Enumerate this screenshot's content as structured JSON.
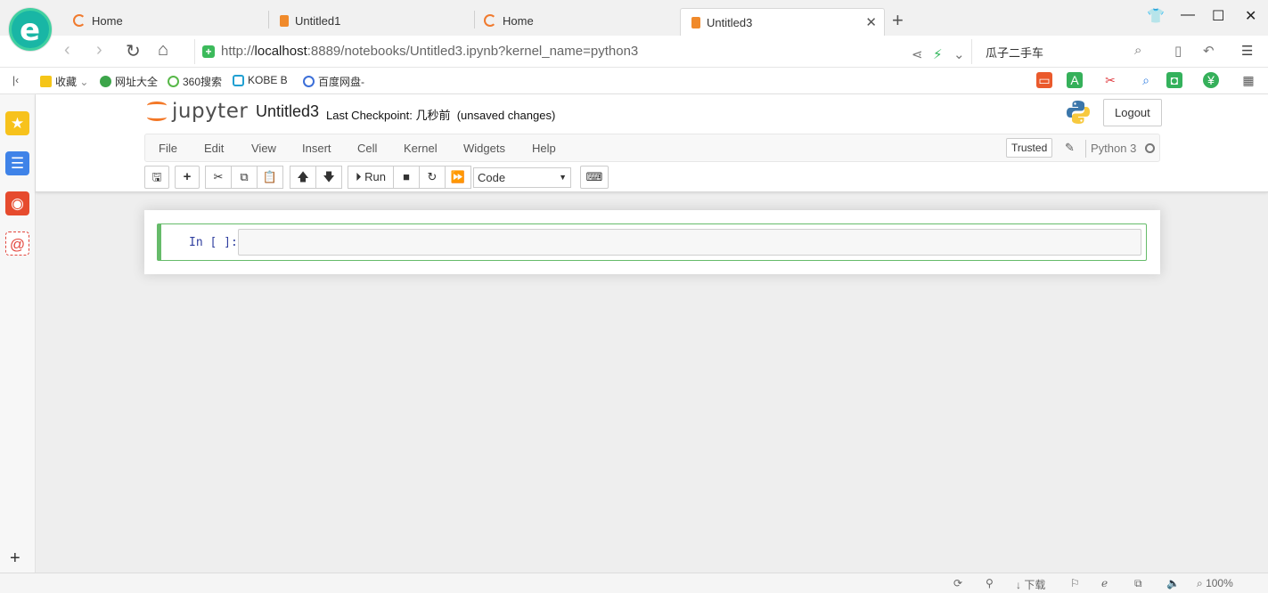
{
  "browser": {
    "tabs": [
      {
        "label": "Home",
        "active": false
      },
      {
        "label": "Untitled1",
        "active": false
      },
      {
        "label": "Home",
        "active": false
      },
      {
        "label": "Untitled3",
        "active": true
      }
    ],
    "url_prefix": "http://",
    "url_host": "localhost",
    "url_rest": ":8889/notebooks/Untitled3.ipynb?kernel_name=python3",
    "search_text": "瓜子二手车",
    "bookmarks": [
      {
        "label": "收藏",
        "icon": "star-icon"
      },
      {
        "label": "网址大全",
        "icon": "globe-icon"
      },
      {
        "label": "360搜索",
        "icon": "search-360-icon"
      },
      {
        "label": "KOBE B",
        "icon": "bilibili-icon"
      },
      {
        "label": "百度网盘-",
        "icon": "baidu-pan-icon"
      }
    ],
    "status": {
      "download": "下载",
      "zoom": "100%"
    },
    "accent": "#19b6a5"
  },
  "jupyter": {
    "logo_text": "jupyter",
    "notebook_name": "Untitled3",
    "checkpoint_label": "Last Checkpoint:",
    "checkpoint_time": "几秒前",
    "save_status": "(unsaved changes)",
    "logout_label": "Logout",
    "menus": [
      "File",
      "Edit",
      "View",
      "Insert",
      "Cell",
      "Kernel",
      "Widgets",
      "Help"
    ],
    "trusted_label": "Trusted",
    "kernel_name": "Python 3",
    "run_label": "Run",
    "cell_type": "Code",
    "cell_prompt": "In [ ]:",
    "cell_border_color": "#66bb6a",
    "logo_color": "#f37726"
  }
}
